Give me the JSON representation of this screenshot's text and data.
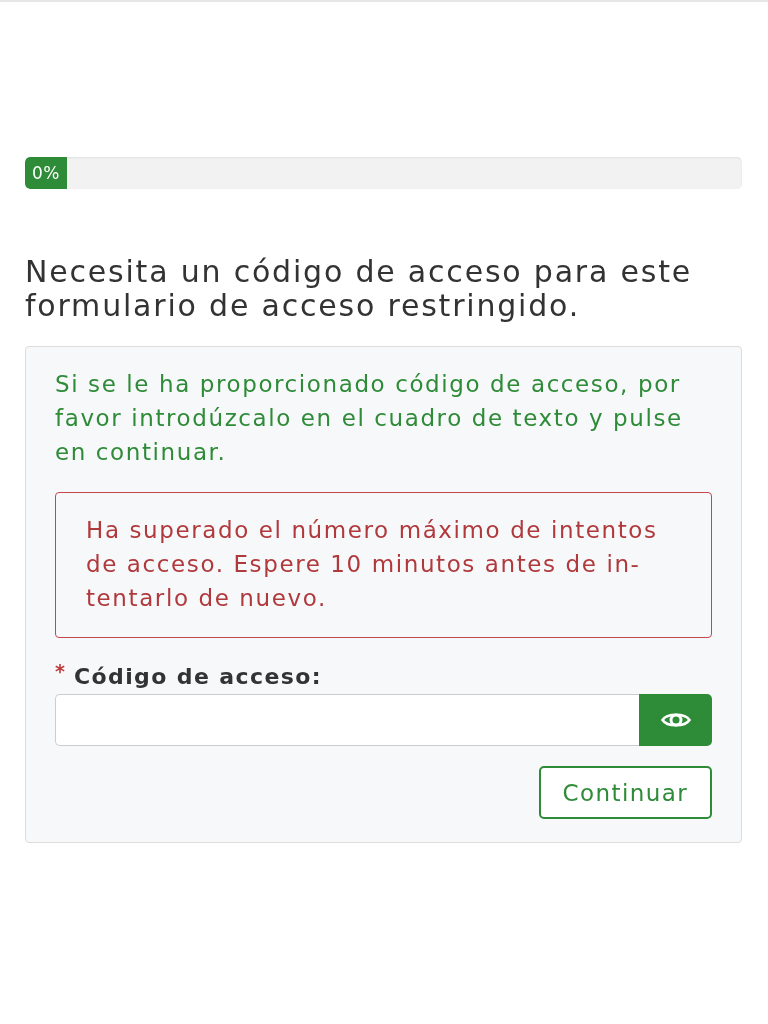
{
  "progress": {
    "label": "0%",
    "level": 0
  },
  "heading": "Necesita un código de acceso para este formulario de acceso restringido.",
  "panel": {
    "instructions": "Si se le ha proporcionado código de acceso, por favor introdúzcalo en el cuadro de texto y pulse en continuar.",
    "error": "Ha superado el número máximo de intentos de acceso. Espere 10 minutos antes de in-tentarlo de nuevo.",
    "field": {
      "label": "Código de acceso:",
      "required": true,
      "required_mark": "*"
    },
    "submit_button": "Continuar"
  }
}
